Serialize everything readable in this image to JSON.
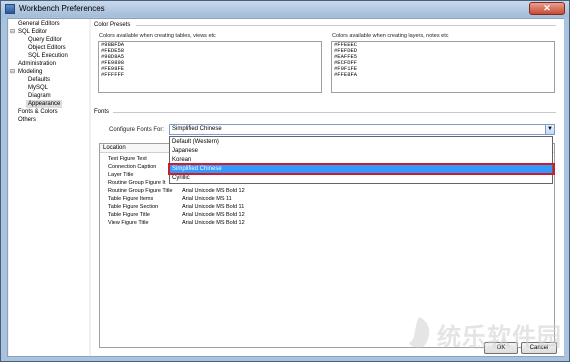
{
  "window": {
    "title": "Workbench Preferences",
    "close_glyph": "✕"
  },
  "sidebar": {
    "items": [
      {
        "label": "General Editors"
      },
      {
        "label": "SQL Editor",
        "toggle": "⊟"
      },
      {
        "label": "Query Editor"
      },
      {
        "label": "Object Editors"
      },
      {
        "label": "SQL Execution"
      },
      {
        "label": "Administration"
      },
      {
        "label": "Modeling",
        "toggle": "⊟"
      },
      {
        "label": "Defaults"
      },
      {
        "label": "MySQL"
      },
      {
        "label": "Diagram"
      },
      {
        "label": "Appearance"
      },
      {
        "label": "Fonts & Colors"
      },
      {
        "label": "Others"
      }
    ]
  },
  "color_presets": {
    "section_title": "Color Presets",
    "tables_label": "Colors available when creating tables, views etc",
    "tables_colors": [
      "#98BFDA",
      "#FEDE58",
      "#98D8A5",
      "#FE9898",
      "#FE98FE",
      "#FFFFFF"
    ],
    "layers_label": "Colors available when creating layers, notes etc",
    "layers_colors": [
      "#FFEEEC",
      "#FEFDED",
      "#EAFFE5",
      "#ECFDFF",
      "#F0F1FE",
      "#FFE8FA"
    ]
  },
  "fonts": {
    "section_title": "Fonts",
    "configure_label": "Configure Fonts For:",
    "configure_value": "Simplified Chinese",
    "dropdown_options": [
      "Default (Western)",
      "Japanese",
      "Korean",
      "Simplified Chinese",
      "Cyrillic"
    ],
    "selected_index": 3,
    "grid_header": "Location",
    "rows": [
      {
        "label": "Text Figure Text",
        "font": ""
      },
      {
        "label": "Connection Caption",
        "font": ""
      },
      {
        "label": "Layer Title",
        "font": ""
      },
      {
        "label": "Routine Group Figure It",
        "font": ""
      },
      {
        "label": "Routine Group Figure Title",
        "font": "Arial Unicode MS Bold 12"
      },
      {
        "label": "Table Figure Items",
        "font": "Arial Unicode MS 11"
      },
      {
        "label": "Table Figure Section",
        "font": "Arial Unicode MS Bold 11"
      },
      {
        "label": "Table Figure Title",
        "font": "Arial Unicode MS Bold 12"
      },
      {
        "label": "View Figure Title",
        "font": "Arial Unicode MS Bold 12"
      }
    ]
  },
  "buttons": {
    "ok": "OK",
    "cancel": "Cancel"
  },
  "watermark": {
    "text": "统乐软件园",
    "url": "www.k8L6.com"
  }
}
